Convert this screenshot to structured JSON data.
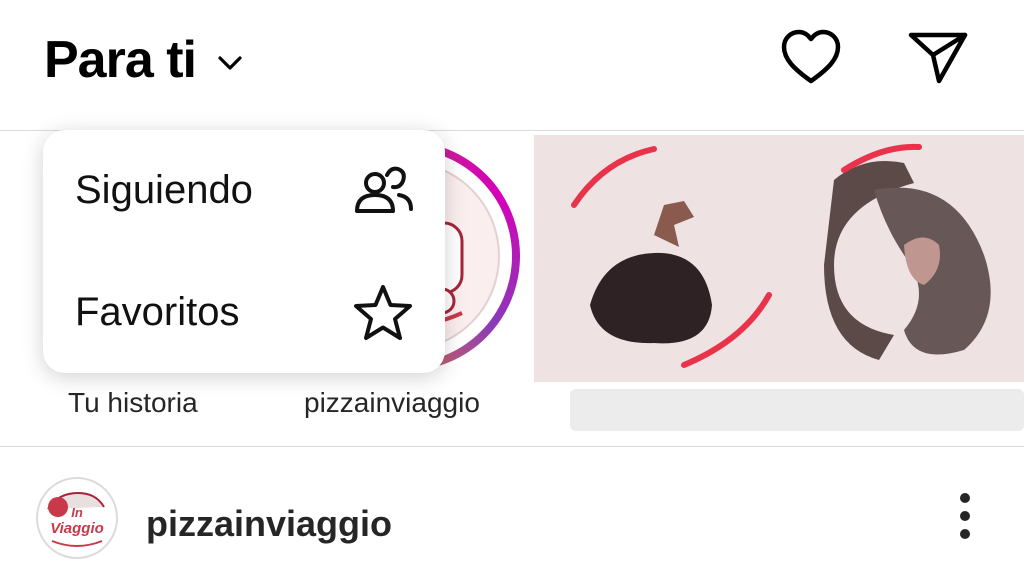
{
  "header": {
    "title": "Para ti",
    "icons": {
      "chevron": "chevron-down-icon",
      "heart": "heart-icon",
      "send": "send-icon"
    }
  },
  "dropdown": {
    "items": [
      {
        "label": "Siguiendo",
        "icon": "people-icon"
      },
      {
        "label": "Favoritos",
        "icon": "star-icon"
      }
    ]
  },
  "stories": [
    {
      "label": "Tu historia"
    },
    {
      "label": "pizzainviaggio"
    }
  ],
  "post": {
    "username": "pizzainviaggio",
    "avatar_text": [
      "In",
      "Viaggio"
    ],
    "more_icon": "more-vertical-icon"
  },
  "colors": {
    "ring_start": "#f58529",
    "ring_mid": "#dd2a7b",
    "ring_end": "#8a3ab9",
    "accent_red": "#e8334a",
    "card_bg": "#efe2e2"
  }
}
